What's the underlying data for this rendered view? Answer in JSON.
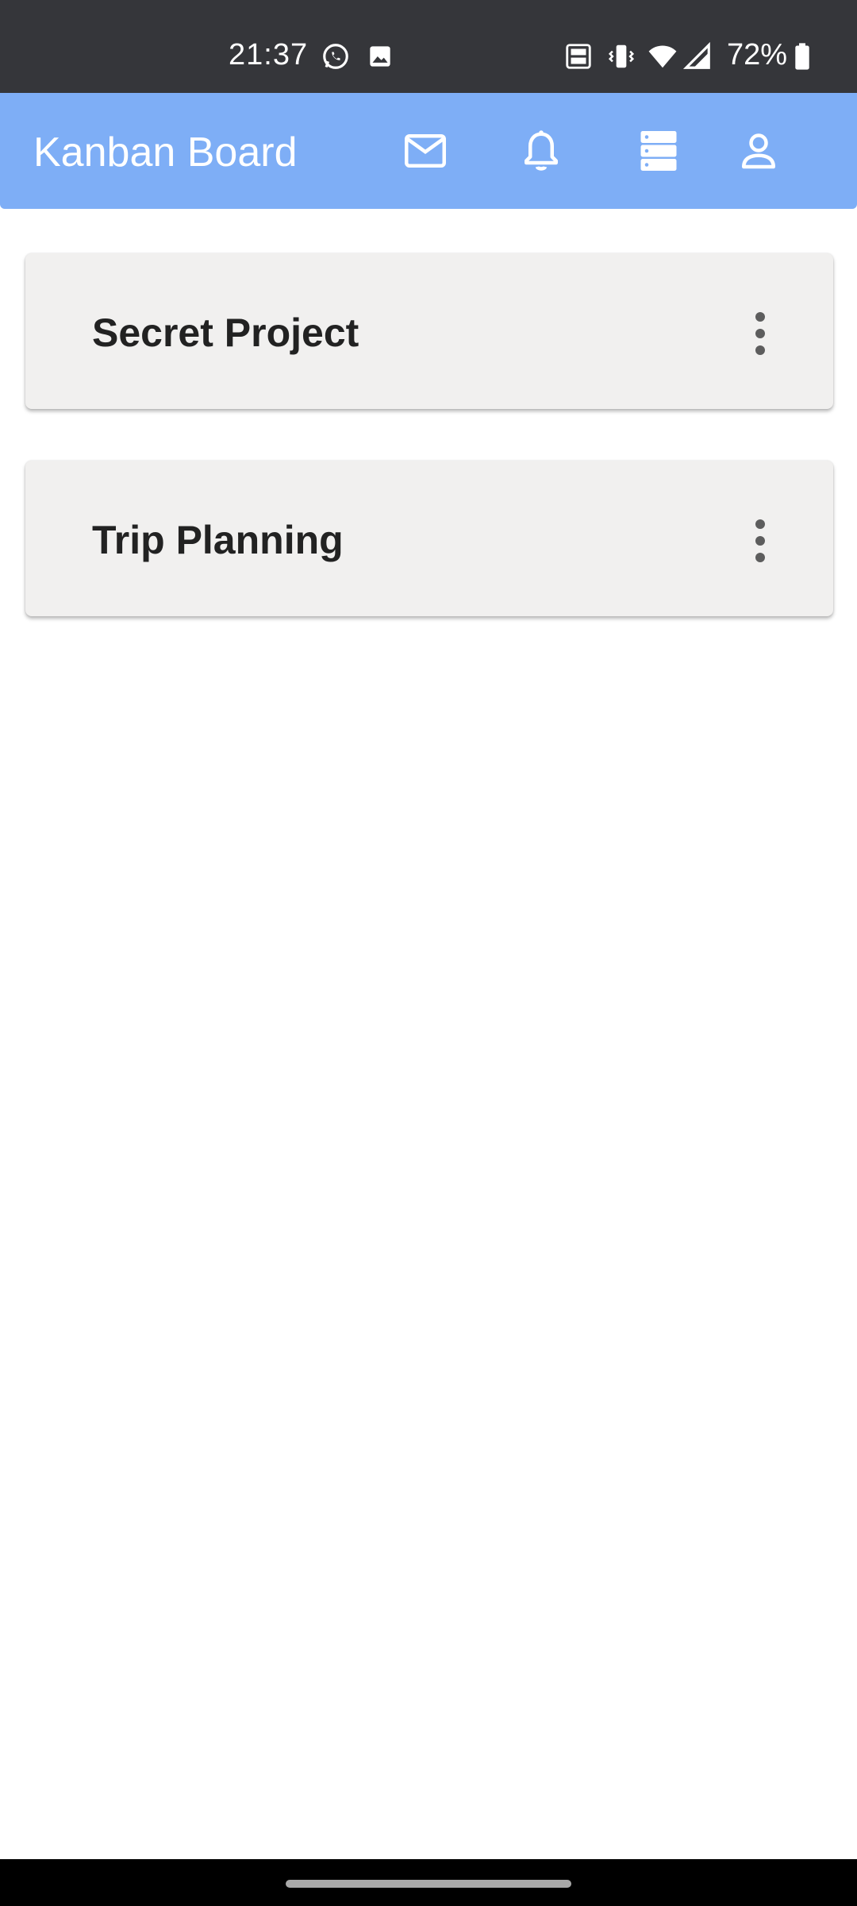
{
  "status_bar": {
    "time": "21:37",
    "battery_percent": "72%",
    "icons": [
      "whatsapp-icon",
      "image-icon",
      "volte-icon",
      "vibrate-icon",
      "wifi-icon",
      "cell-signal-icon",
      "battery-icon"
    ]
  },
  "app_bar": {
    "title": "Kanban Board",
    "actions": [
      "mail-icon",
      "bell-icon",
      "server-icon",
      "account-icon"
    ],
    "background_color": "#7eaef6"
  },
  "boards": [
    {
      "title": "Secret Project"
    },
    {
      "title": "Trip Planning"
    }
  ],
  "colors": {
    "status_bar": "#35363a",
    "card_background": "#f1f0ef",
    "card_text": "#222222"
  }
}
